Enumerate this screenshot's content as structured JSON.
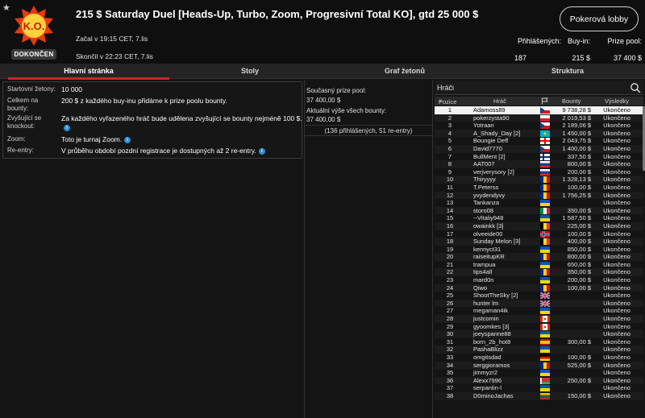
{
  "header": {
    "title": "215 $ Saturday Duel [Heads-Up, Turbo, Zoom, Progresivní Total KO], gtd 25 000 $",
    "logo_text": "K.O.",
    "status_badge": "DOKONČEN",
    "started": "Začal v 19:15 CET, 7.lis",
    "ended": "Skončil v 22:23 CET, 7.lis",
    "lobby_button": "Pokerová lobby",
    "stats": {
      "registered_label": "Přihlášených:",
      "registered_value": "187",
      "buyin_label": "Buy-in:",
      "buyin_value": "215 $",
      "prize_label": "Prize pool:",
      "prize_value": "37 400 $"
    }
  },
  "tabs": [
    "Hlavní stránka",
    "Stoly",
    "Graf žetonů",
    "Struktura"
  ],
  "info": {
    "starting_chips_label": "Startovní žetony:",
    "starting_chips_value": "10 000",
    "total_bounty_label": "Celkem na bounty:",
    "total_bounty_value": "200 $ z každého buy-inu přidáme k prize poolu bounty.",
    "increasing_bounty_label": "Zvyšující se knockout:",
    "increasing_bounty_value": "Za každého vyřazeného hráč bude udělena zvyšující se bounty nejméně 100 $.",
    "zoom_label": "Zoom:",
    "zoom_value": "Toto je turnaj Zoom.",
    "reentry_label": "Re-entry:",
    "reentry_value": "V průběhu období pozdní registrace je dostupných až 2 re-entry."
  },
  "pool": {
    "current_label": "Současný prize pool:",
    "current_value": "37 400,00 $",
    "bounty_label": "Aktuální výše všech bounty:",
    "bounty_value": "37 400,00 $",
    "entries": "(136 přihlášených, 51 re-entry)"
  },
  "players": {
    "search_placeholder": "Hráči",
    "headers": {
      "pos": "Pozice",
      "player": "Hráč",
      "bounty": "Bounty",
      "results": "Výsledky"
    },
    "result_text": "Ukončeno",
    "list": [
      {
        "pos": "1",
        "name": "Adamoss89",
        "bounty": "9 738,28 $",
        "flag": "cz"
      },
      {
        "pos": "2",
        "name": "pokerzysta90",
        "bounty": "2 019,53 $",
        "flag": "pl"
      },
      {
        "pos": "3",
        "name": "Yotraan",
        "bounty": "2 189,06 $",
        "flag": "cz"
      },
      {
        "pos": "4",
        "name": "A_Shady_Day [2]",
        "bounty": "1 450,00 $",
        "flag": "kz"
      },
      {
        "pos": "5",
        "name": "Boungie Deff",
        "bounty": "2 043,75 $",
        "flag": "ge"
      },
      {
        "pos": "6",
        "name": "David7770",
        "bounty": "1 400,00 $",
        "flag": "cz"
      },
      {
        "pos": "7",
        "name": "BullMent [2]",
        "bounty": "337,50 $",
        "flag": "fi"
      },
      {
        "pos": "8",
        "name": "AAT007",
        "bounty": "800,00 $",
        "flag": "ru"
      },
      {
        "pos": "9",
        "name": "verjverysory [2]",
        "bounty": "200,00 $",
        "flag": "ru"
      },
      {
        "pos": "10",
        "name": "Thiryyyy",
        "bounty": "1 328,13 $",
        "flag": "ro"
      },
      {
        "pos": "11",
        "name": "T.Peterss",
        "bounty": "100,00 $",
        "flag": "ro"
      },
      {
        "pos": "12",
        "name": "yvydendyvy",
        "bounty": "1 756,25 $",
        "flag": "ro"
      },
      {
        "pos": "13",
        "name": "Tankanza",
        "bounty": "",
        "flag": "ua"
      },
      {
        "pos": "14",
        "name": "storo08",
        "bounty": "350,00 $",
        "flag": "it"
      },
      {
        "pos": "15",
        "name": "--Vitaliy948",
        "bounty": "1 587,50 $",
        "flag": "ua"
      },
      {
        "pos": "16",
        "name": "owainkk [3]",
        "bounty": "225,00 $",
        "flag": "be"
      },
      {
        "pos": "17",
        "name": "olveeide00",
        "bounty": "100,00 $",
        "flag": "no"
      },
      {
        "pos": "18",
        "name": "Sunday Melon [3]",
        "bounty": "400,00 $",
        "flag": "be"
      },
      {
        "pos": "19",
        "name": "kennyct31",
        "bounty": "850,00 $",
        "flag": "ua"
      },
      {
        "pos": "20",
        "name": "raiseitupKR",
        "bounty": "800,00 $",
        "flag": "ro"
      },
      {
        "pos": "21",
        "name": "trampua",
        "bounty": "650,00 $",
        "flag": "ua"
      },
      {
        "pos": "22",
        "name": "tips4all",
        "bounty": "350,00 $",
        "flag": "ro"
      },
      {
        "pos": "23",
        "name": "mard0n",
        "bounty": "200,00 $",
        "flag": "ua"
      },
      {
        "pos": "24",
        "name": "Qiwo",
        "bounty": "100,00 $",
        "flag": "ro"
      },
      {
        "pos": "25",
        "name": "ShootTheSky [2]",
        "bounty": "",
        "flag": "gb"
      },
      {
        "pos": "26",
        "name": "hunter lm",
        "bounty": "",
        "flag": "gb"
      },
      {
        "pos": "27",
        "name": "megaman4ik",
        "bounty": "",
        "flag": "ua"
      },
      {
        "pos": "28",
        "name": "justcomin",
        "bounty": "",
        "flag": "ca"
      },
      {
        "pos": "29",
        "name": "gyoomkes [3]",
        "bounty": "",
        "flag": "ca"
      },
      {
        "pos": "30",
        "name": "joeyspanne88",
        "bounty": "",
        "flag": "ua"
      },
      {
        "pos": "31",
        "name": "born_2b_hot8",
        "bounty": "300,00 $",
        "flag": "es"
      },
      {
        "pos": "32",
        "name": "PashaBlizz",
        "bounty": "",
        "flag": "ua"
      },
      {
        "pos": "33",
        "name": "omgitsdad",
        "bounty": "100,00 $",
        "flag": "de"
      },
      {
        "pos": "34",
        "name": "serggioramos",
        "bounty": "525,00 $",
        "flag": "ro"
      },
      {
        "pos": "35",
        "name": "jimmyzr2",
        "bounty": "",
        "flag": "ua"
      },
      {
        "pos": "36",
        "name": "Alexx7996",
        "bounty": "250,00 $",
        "flag": "by"
      },
      {
        "pos": "37",
        "name": "serpantin-l",
        "bounty": "",
        "flag": "ua"
      },
      {
        "pos": "38",
        "name": "D0minoJachas",
        "bounty": "150,00 $",
        "flag": "lt"
      }
    ]
  },
  "colors": {
    "accent": "#c62828",
    "info_icon": "#2a8ed8"
  }
}
